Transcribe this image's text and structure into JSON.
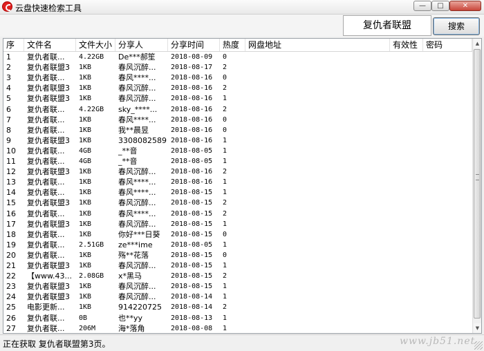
{
  "window": {
    "title": "云盘快速检索工具",
    "minimize_glyph": "—",
    "maximize_glyph": "□",
    "close_glyph": "✕"
  },
  "search": {
    "query": "复仇者联盟",
    "button_label": "搜索"
  },
  "table": {
    "columns": [
      "序",
      "文件名",
      "文件大小",
      "分享人",
      "分享时间",
      "热度",
      "网盘地址",
      "有效性",
      "密码"
    ],
    "rows": [
      [
        "1",
        "复仇者联...",
        "4.22GB",
        "De***郝笙",
        "2018-08-09",
        "0"
      ],
      [
        "2",
        "复仇者联盟3",
        "1KB",
        "春风沉醉...",
        "2018-08-17",
        "2"
      ],
      [
        "3",
        "复仇者联...",
        "1KB",
        "春风****...",
        "2018-08-16",
        "0"
      ],
      [
        "4",
        "复仇者联盟3",
        "1KB",
        "春风沉醉...",
        "2018-08-16",
        "2"
      ],
      [
        "5",
        "复仇者联盟3",
        "1KB",
        "春风沉醉...",
        "2018-08-16",
        "1"
      ],
      [
        "6",
        "复仇者联...",
        "4.22GB",
        "sky_****...",
        "2018-08-16",
        "2"
      ],
      [
        "7",
        "复仇者联...",
        "1KB",
        "春风****...",
        "2018-08-16",
        "0"
      ],
      [
        "8",
        "复仇者联...",
        "1KB",
        "我**晨昱",
        "2018-08-16",
        "0"
      ],
      [
        "9",
        "复仇者联盟3",
        "1KB",
        "3308082589",
        "2018-08-16",
        "1"
      ],
      [
        "10",
        "复仇者联...",
        "4GB",
        "_**音  ",
        "2018-08-05",
        "1"
      ],
      [
        "11",
        "复仇者联...",
        "4GB",
        "_**音  ",
        "2018-08-05",
        "1"
      ],
      [
        "12",
        "复仇者联盟3",
        "1KB",
        "春风沉醉...",
        "2018-08-16",
        "2"
      ],
      [
        "13",
        "复仇者联...",
        "1KB",
        "春风****...",
        "2018-08-16",
        "1"
      ],
      [
        "14",
        "复仇者联...",
        "1KB",
        "春风****...",
        "2018-08-15",
        "1"
      ],
      [
        "15",
        "复仇者联盟3",
        "1KB",
        "春风沉醉...",
        "2018-08-15",
        "2"
      ],
      [
        "16",
        "复仇者联...",
        "1KB",
        "春风****...",
        "2018-08-15",
        "2"
      ],
      [
        "17",
        "复仇者联盟3",
        "1KB",
        "春风沉醉...",
        "2018-08-15",
        "1"
      ],
      [
        "18",
        "复仇者联...",
        "1KB",
        "你好***日葵",
        "2018-08-15",
        "0"
      ],
      [
        "19",
        "复仇者联...",
        "2.51GB",
        "ze***ime",
        "2018-08-05",
        "1"
      ],
      [
        "20",
        "复仇者联...",
        "1KB",
        "殇**花落",
        "2018-08-15",
        "0"
      ],
      [
        "21",
        "复仇者联盟3",
        "1KB",
        "春风沉醉...",
        "2018-08-15",
        "1"
      ],
      [
        "22",
        "【www.43...",
        "2.08GB",
        "x*黑马",
        "2018-08-15",
        "2"
      ],
      [
        "23",
        "复仇者联盟3",
        "1KB",
        "春风沉醉...",
        "2018-08-15",
        "1"
      ],
      [
        "24",
        "复仇者联盟3",
        "1KB",
        "春风沉醉...",
        "2018-08-14",
        "1"
      ],
      [
        "25",
        "电影更新...",
        "1KB",
        "914220725",
        "2018-08-14",
        "2"
      ],
      [
        "26",
        "复仇者联...",
        "0B",
        "也**yy",
        "2018-08-13",
        "1"
      ],
      [
        "27",
        "复仇者联...",
        "206M",
        "海*落角",
        "2018-08-08",
        "1"
      ]
    ]
  },
  "status": {
    "text": "正在获取 复仇者联盟第3页。"
  },
  "watermark": {
    "text": "www.jb51.net"
  }
}
